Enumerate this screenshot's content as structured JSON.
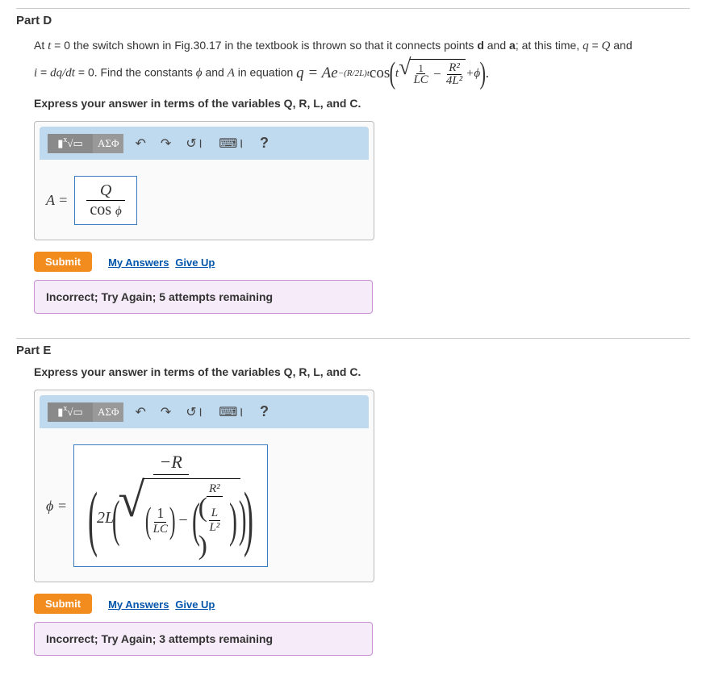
{
  "partD": {
    "title": "Part D",
    "text1_a": "At ",
    "text1_b": " = 0 the switch shown in Fig.30.17 in the textbook is thrown so that it connects points ",
    "text1_c": " and ",
    "text1_d": "; at this time, ",
    "text1_e": " and",
    "text2_a": " = 0. Find the constants ",
    "text2_b": " and ",
    "text2_c": " in equation ",
    "eq_lhs": "q = Ae",
    "eq_exp": "−(R/2L)t",
    "eq_cos": " cos",
    "t_var": "t",
    "i_var": "i",
    "dqdt": "dq/dt",
    "phi": "ϕ",
    "A": "A",
    "d": "d",
    "a": "a",
    "q": "q",
    "Q": "Q",
    "one": "1",
    "LC": "LC",
    "R2": "R²",
    "fourL2": "4L²",
    "plusphi": "+ϕ",
    "express": "Express your answer in terms of the variables Q, R, L, and C.",
    "var_label": "A =",
    "answer_num": "Q",
    "answer_den": "cos ϕ",
    "submit": "Submit",
    "my_answers": "My Answers",
    "give_up": "Give Up",
    "feedback": "Incorrect; Try Again; 5 attempts remaining"
  },
  "partE": {
    "title": "Part E",
    "express": "Express your answer in terms of the variables Q, R, L, and C.",
    "var_label": "ϕ =",
    "topR": "−R",
    "twoL": "2L",
    "one": "1",
    "LC": "LC",
    "minus": "−",
    "R2": "R²",
    "L": "L",
    "L2": "L²",
    "submit": "Submit",
    "my_answers": "My Answers",
    "give_up": "Give Up",
    "feedback": "Incorrect; Try Again; 3 attempts remaining"
  },
  "toolbar": {
    "greek": "ΑΣΦ",
    "help": "?"
  }
}
